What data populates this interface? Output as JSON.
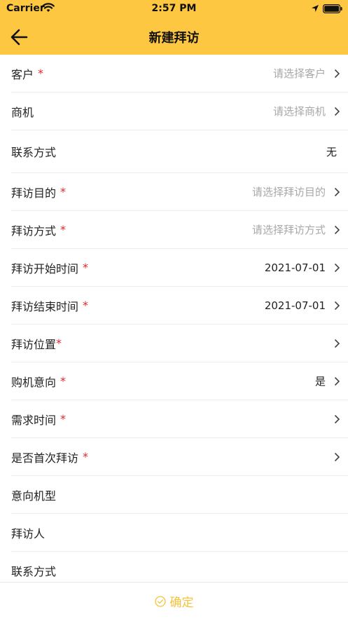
{
  "status_bar": {
    "carrier": "Carrier",
    "time": "2:57 PM"
  },
  "nav": {
    "title": "新建拜访"
  },
  "form": {
    "rows": [
      {
        "label": "客户",
        "required": "*",
        "value": "请选择客户"
      },
      {
        "label": "商机",
        "value": "请选择商机"
      },
      {
        "label": "联系方式",
        "value": "无"
      },
      {
        "label": "拜访目的",
        "required": "*",
        "value": "请选择拜访目的"
      },
      {
        "label": "拜访方式",
        "required": "*",
        "value": "请选择拜访方式"
      },
      {
        "label": "拜访开始时间",
        "required": "*",
        "value": "2021-07-01"
      },
      {
        "label": "拜访结束时间",
        "required": "*",
        "value": "2021-07-01"
      },
      {
        "label": "拜访位置",
        "required": "*"
      },
      {
        "label": "购机意向",
        "required": "*",
        "value": "是"
      },
      {
        "label": "需求时间",
        "required": "*"
      },
      {
        "label": "是否首次拜访",
        "required": "*"
      },
      {
        "label": "意向机型"
      },
      {
        "label": "拜访人"
      },
      {
        "label": "联系方式"
      }
    ]
  },
  "footer": {
    "confirm_label": "确定"
  },
  "colors": {
    "header": "#fdc742",
    "required": "#e0262a",
    "placeholder": "#a8a8a8",
    "confirm": "#f4c23b"
  }
}
